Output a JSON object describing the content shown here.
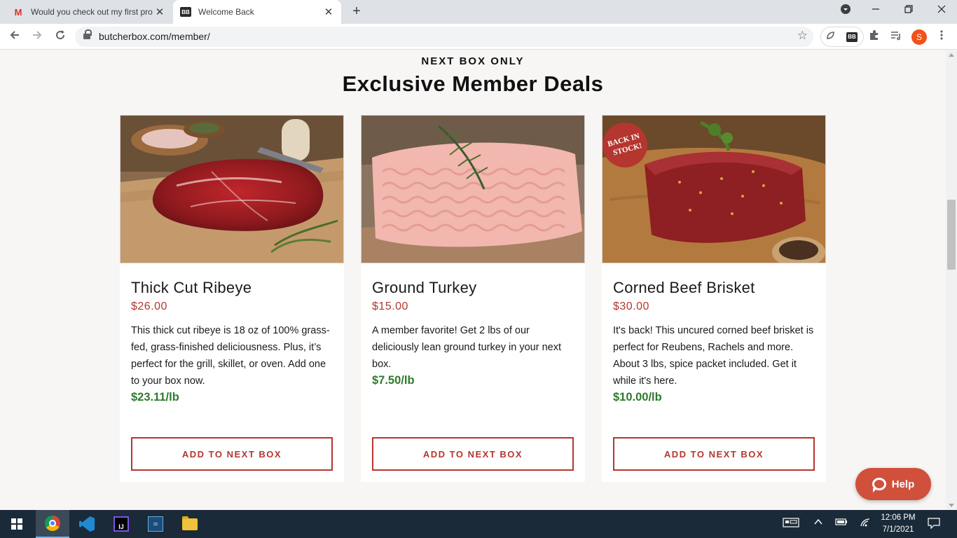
{
  "browser": {
    "tabs": [
      {
        "title": "Would you check out my first pro",
        "icon": "gmail-icon",
        "favicon_text": "M"
      },
      {
        "title": "Welcome Back",
        "icon": "butcherbox-favicon",
        "favicon_text": "BB"
      }
    ],
    "close_glyph": "✕",
    "new_tab_glyph": "+",
    "url": "butcherbox.com/member/",
    "profile_initial": "S",
    "extension_badge": "BB"
  },
  "page": {
    "eyebrow": "NEXT BOX ONLY",
    "heading": "Exclusive Member Deals",
    "products": [
      {
        "name": "Thick Cut Ribeye",
        "price": "$26.00",
        "description": "This thick cut ribeye is 18 oz of 100% grass-fed, grass-finished deliciousness. Plus, it’s perfect for the grill, skillet, or oven. Add one to your box now.",
        "unit_price": "$23.11/lb",
        "button": "ADD TO NEXT BOX"
      },
      {
        "name": "Ground Turkey",
        "price": "$15.00",
        "description": "A member favorite! Get 2 lbs of our deliciously lean ground turkey in your next box.",
        "unit_price": "$7.50/lb",
        "button": "ADD TO NEXT BOX"
      },
      {
        "name": "Corned Beef Brisket",
        "price": "$30.00",
        "description": "It's back! This uncured corned beef brisket is perfect for Reubens, Rachels and more. About 3 lbs, spice packet included. Get it while it's here.",
        "unit_price": "$10.00/lb",
        "button": "ADD TO NEXT BOX",
        "badge": "BACK IN STOCK!"
      }
    ],
    "help_label": "Help"
  },
  "taskbar": {
    "time": "12:06 PM",
    "date": "7/1/2021"
  },
  "colors": {
    "accent_red": "#b5362f",
    "unit_green": "#2f7a2f",
    "help_bg": "#d0503c",
    "page_bg": "#f7f6f5"
  }
}
